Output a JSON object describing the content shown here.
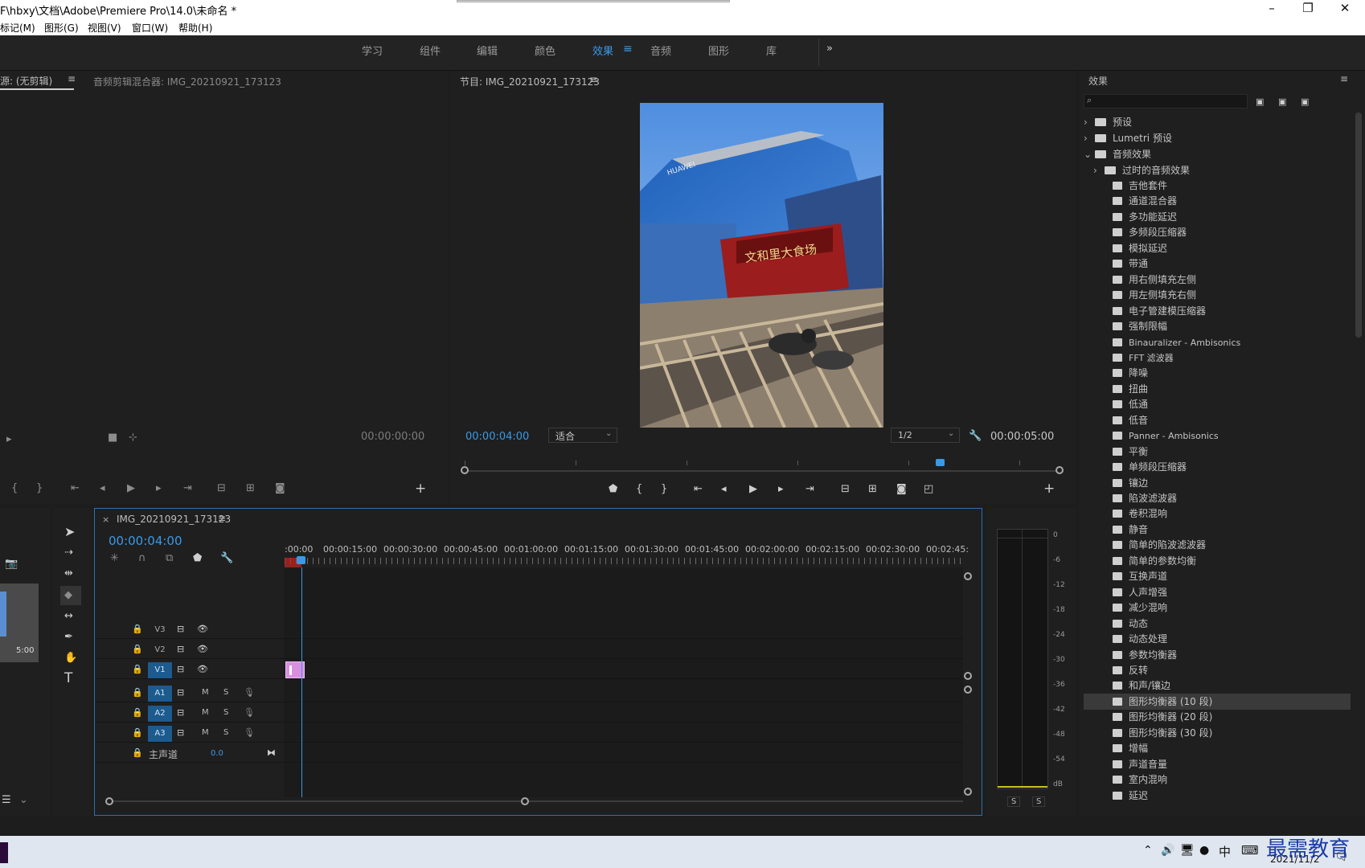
{
  "window": {
    "title": "F\\hbxy\\文档\\Adobe\\Premiere Pro\\14.0\\未命名 *",
    "controls": [
      "–",
      "❐",
      "✕"
    ]
  },
  "menu": [
    "标记(M)",
    "图形(G)",
    "视图(V)",
    "窗口(W)",
    "帮助(H)"
  ],
  "workspaces": [
    "学习",
    "组件",
    "编辑",
    "颜色",
    "效果",
    "音频",
    "图形",
    "库"
  ],
  "workspace_active": "效果",
  "source_panel": {
    "tab1": "源: (无剪辑)",
    "tab2": "音频剪辑混合器: IMG_20210921_173123",
    "timecode": "00:00:00:00"
  },
  "program_panel": {
    "title": "节目: IMG_20210921_173123",
    "timecode": "00:00:04:00",
    "fit": "适合",
    "resolution": "1/2",
    "duration": "00:00:05:00",
    "sign_text": "文和里大食场",
    "building_text": "HUAWEI"
  },
  "project_thumb": {
    "duration": "5:00"
  },
  "timeline": {
    "sequence": "IMG_20210921_173123",
    "timecode": "00:00:04:00",
    "ruler": [
      ":00:00",
      "00:00:15:00",
      "00:00:30:00",
      "00:00:45:00",
      "00:01:00:00",
      "00:01:15:00",
      "00:01:30:00",
      "00:01:45:00",
      "00:02:00:00",
      "00:02:15:00",
      "00:02:30:00",
      "00:02:45:"
    ],
    "tracks": [
      {
        "name": "V3",
        "targeted": false,
        "type": "video"
      },
      {
        "name": "V2",
        "targeted": false,
        "type": "video"
      },
      {
        "name": "V1",
        "targeted": true,
        "type": "video"
      },
      {
        "name": "A1",
        "targeted": true,
        "type": "audio"
      },
      {
        "name": "A2",
        "targeted": true,
        "type": "audio"
      },
      {
        "name": "A3",
        "targeted": true,
        "type": "audio"
      }
    ],
    "mute_label": "M",
    "solo_label": "S",
    "master": {
      "label": "主声道",
      "value": "0.0"
    }
  },
  "audio_meter": {
    "scale": [
      "0",
      "-6",
      "-12",
      "-18",
      "-24",
      "-30",
      "-36",
      "-42",
      "-48",
      "-54",
      "dB"
    ],
    "solo_labels": [
      "S",
      "S"
    ]
  },
  "effects_panel": {
    "title": "效果",
    "search_placeholder": "",
    "folders": [
      "预设",
      "Lumetri 预设",
      "音频效果",
      "过时的音频效果"
    ],
    "items": [
      "吉他套件",
      "通道混合器",
      "多功能延迟",
      "多频段压缩器",
      "模拟延迟",
      "带通",
      "用右侧填充左侧",
      "用左侧填充右侧",
      "电子管建模压缩器",
      "强制限幅",
      "Binauralizer - Ambisonics",
      "FFT 滤波器",
      "降噪",
      "扭曲",
      "低通",
      "低音",
      "Panner - Ambisonics",
      "平衡",
      "单频段压缩器",
      "镶边",
      "陷波滤波器",
      "卷积混响",
      "静音",
      "简单的陷波滤波器",
      "简单的参数均衡",
      "互换声道",
      "人声增强",
      "减少混响",
      "动态",
      "动态处理",
      "参数均衡器",
      "反转",
      "和声/镶边",
      "图形均衡器 (10 段)",
      "图形均衡器 (20 段)",
      "图形均衡器 (30 段)",
      "增幅",
      "声道音量",
      "室内混响",
      "延迟"
    ],
    "selected": "图形均衡器 (10 段)"
  },
  "taskbar": {
    "ime": "中",
    "date": "2021/11/2",
    "watermark": "最需教育"
  },
  "colors": {
    "accent": "#3a9ae8",
    "clip": "#d98ee0",
    "target": "#1d5a8e"
  }
}
